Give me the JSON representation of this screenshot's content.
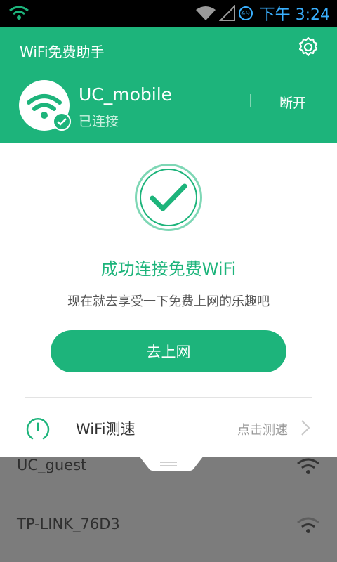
{
  "status_bar": {
    "time": "下午 3:24",
    "battery": "49",
    "icons": [
      "wifi-icon",
      "wifi-icon",
      "signal-icon",
      "battery-icon"
    ]
  },
  "header": {
    "title": "WiFi免费助手",
    "settings_icon": "gear-icon",
    "connected": {
      "ssid": "UC_mobile",
      "status": "已连接",
      "disconnect_label": "断开"
    }
  },
  "main": {
    "success_title": "成功连接免费WiFi",
    "success_subtitle": "现在就去享受一下免费上网的乐趣吧",
    "go_button": "去上网",
    "speed_test": {
      "label": "WiFi测速",
      "action": "点击测速"
    }
  },
  "networks": [
    {
      "name": "UC_guest",
      "signal_icon": "wifi-icon"
    },
    {
      "name": "TP-LINK_76D3",
      "signal_icon": "wifi-weak-icon"
    }
  ],
  "colors": {
    "accent": "#1db47b",
    "overlay": "#7c7c7c",
    "status_blue": "#3ab0ff"
  }
}
